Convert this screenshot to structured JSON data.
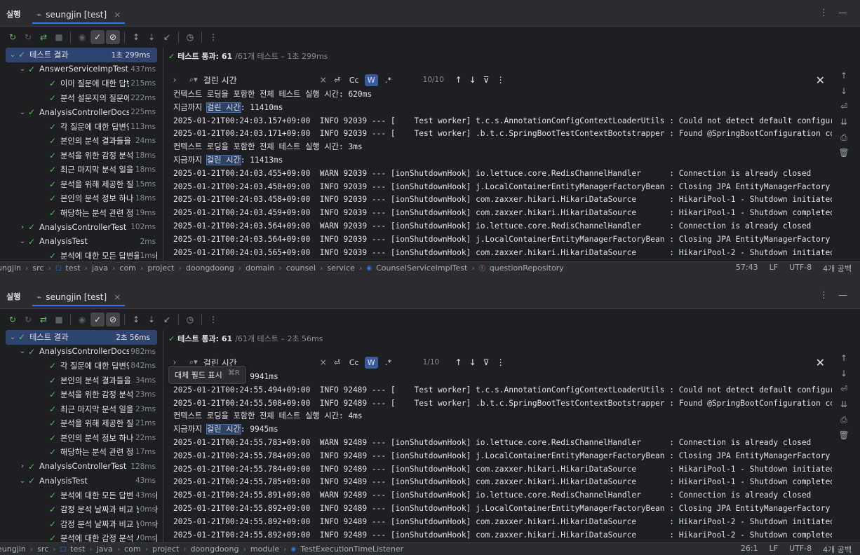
{
  "panels": [
    {
      "run_label": "실행",
      "tab_title": "seungjin [test]",
      "status": {
        "passed": "테스트 통과: 61",
        "rest": "/61개 테스트 – 1초 299ms"
      },
      "search": {
        "query": "걸린 시간",
        "match_count": "10/10",
        "case_label": "Cc",
        "word_label": "W",
        "regex_label": ".*"
      },
      "tree": [
        {
          "level": 0,
          "chev": "v",
          "name": "테스트 결과",
          "time": "1초 299ms",
          "selected": true
        },
        {
          "level": 1,
          "chev": "v",
          "name": "AnswerServiceImpTest",
          "time": "437ms"
        },
        {
          "level": 2,
          "chev": "",
          "name": "이미 질문에 대한 답변이 존",
          "time": "215ms"
        },
        {
          "level": 2,
          "chev": "",
          "name": "분석 설문지의 질문에 대한",
          "time": "222ms"
        },
        {
          "level": 1,
          "chev": "v",
          "name": "AnalysisControllerDocsTest",
          "time": "225ms"
        },
        {
          "level": 2,
          "chev": "",
          "name": "각 질문에 대한 답변인 응답",
          "time": "113ms"
        },
        {
          "level": 2,
          "chev": "",
          "name": "본인의 분석 결과들을 페이지",
          "time": "24ms"
        },
        {
          "level": 2,
          "chev": "",
          "name": "분석을 위한 감정 분석 설문",
          "time": "18ms"
        },
        {
          "level": 2,
          "chev": "",
          "name": "최근 마지막 분석 일을 기준",
          "time": "18ms"
        },
        {
          "level": 2,
          "chev": "",
          "name": "분석을 위해 제공한 질문들",
          "time": "15ms"
        },
        {
          "level": 2,
          "chev": "",
          "name": "본인의 분석 정보 하나를 조",
          "time": "18ms"
        },
        {
          "level": 2,
          "chev": "",
          "name": "해당하는 분석 관련 정보를",
          "time": "19ms"
        },
        {
          "level": 1,
          "chev": ">",
          "name": "AnalysisControllerTest",
          "time": "102ms"
        },
        {
          "level": 1,
          "chev": "v",
          "name": "AnalysisTest",
          "time": "2ms"
        },
        {
          "level": 2,
          "chev": "",
          "name": "분석에 대한 모든 답변을 행태",
          "time": "1ms"
        }
      ],
      "console": [
        "컨텍스트 로딩을 포함한 전체 테스트 실행 시간: 620ms",
        "지금까지 |걸린 시간|: 11410ms",
        "2025-01-21T00:24:03.157+09:00  INFO 92039 --- [    Test worker] t.c.s.AnnotationConfigContextLoaderUtils : Could not detect default configura",
        "2025-01-21T00:24:03.171+09:00  INFO 92039 --- [    Test worker] .b.t.c.SpringBootTestContextBootstrapper : Found @SpringBootConfiguration com",
        "컨텍스트 로딩을 포함한 전체 테스트 실행 시간: 3ms",
        "지금까지 |걸린 시간|: 11413ms",
        "2025-01-21T00:24:03.455+09:00  WARN 92039 --- [ionShutdownHook] io.lettuce.core.RedisChannelHandler      : Connection is already closed",
        "2025-01-21T00:24:03.458+09:00  INFO 92039 --- [ionShutdownHook] j.LocalContainerEntityManagerFactoryBean : Closing JPA EntityManagerFactory f",
        "2025-01-21T00:24:03.458+09:00  INFO 92039 --- [ionShutdownHook] com.zaxxer.hikari.HikariDataSource       : HikariPool-1 - Shutdown initiated.",
        "2025-01-21T00:24:03.459+09:00  INFO 92039 --- [ionShutdownHook] com.zaxxer.hikari.HikariDataSource       : HikariPool-1 - Shutdown completed.",
        "2025-01-21T00:24:03.564+09:00  WARN 92039 --- [ionShutdownHook] io.lettuce.core.RedisChannelHandler      : Connection is already closed",
        "2025-01-21T00:24:03.564+09:00  INFO 92039 --- [ionShutdownHook] j.LocalContainerEntityManagerFactoryBean : Closing JPA EntityManagerFactory f",
        "2025-01-21T00:24:03.565+09:00  INFO 92039 --- [ionShutdownHook] com.zaxxer.hikari.HikariDataSource       : HikariPool-2 - Shutdown initiated."
      ],
      "breadcrumb": [
        "ungjin",
        "src",
        "test",
        "java",
        "com",
        "project",
        "doongdoong",
        "domain",
        "counsel",
        "service",
        "CounselServiceImplTest",
        "questionRepository"
      ],
      "status_right": [
        "57:43",
        "LF",
        "UTF-8",
        "4개 공백"
      ]
    },
    {
      "run_label": "실행",
      "tab_title": "seungjin [test]",
      "status": {
        "passed": "테스트 통과: 61",
        "rest": "/61개 테스트 – 2초 56ms"
      },
      "search": {
        "query": "걸린 시간",
        "match_count": "1/10",
        "case_label": "Cc",
        "word_label": "W",
        "regex_label": ".*"
      },
      "tooltip": {
        "label": "대체 필드 표시",
        "shortcut": "⌘R"
      },
      "tree": [
        {
          "level": 0,
          "chev": "v",
          "name": "테스트 결과",
          "time": "2초 56ms",
          "selected": true
        },
        {
          "level": 1,
          "chev": "v",
          "name": "AnalysisControllerDocsTest",
          "time": "982ms"
        },
        {
          "level": 2,
          "chev": "",
          "name": "각 질문에 대한 답변인 응답",
          "time": "842ms"
        },
        {
          "level": 2,
          "chev": "",
          "name": "본인의 분석 결과들을 페이지",
          "time": "34ms"
        },
        {
          "level": 2,
          "chev": "",
          "name": "분석을 위한 감정 분석 설문",
          "time": "23ms"
        },
        {
          "level": 2,
          "chev": "",
          "name": "최근 마지막 분석 일을 기준",
          "time": "23ms"
        },
        {
          "level": 2,
          "chev": "",
          "name": "분석을 위해 제공한 질문들",
          "time": "21ms"
        },
        {
          "level": 2,
          "chev": "",
          "name": "본인의 분석 정보 하나를 조",
          "time": "22ms"
        },
        {
          "level": 2,
          "chev": "",
          "name": "해당하는 분석 관련 정보를",
          "time": "17ms"
        },
        {
          "level": 1,
          "chev": ">",
          "name": "AnalysisControllerTest",
          "time": "128ms"
        },
        {
          "level": 1,
          "chev": "v",
          "name": "AnalysisTest",
          "time": "43ms"
        },
        {
          "level": 2,
          "chev": "",
          "name": "분석에 대한 모든 답변을 행태",
          "time": "43ms"
        },
        {
          "level": 2,
          "chev": "",
          "name": "감정 분석 날짜과 비교 날짜가",
          "time": "0ms"
        },
        {
          "level": 2,
          "chev": "",
          "name": "감정 분석 날짜과 비교 날짜가",
          "time": "0ms"
        },
        {
          "level": 2,
          "chev": "",
          "name": "분석에 대한 감정 분석 시간이",
          "time": "0ms"
        }
      ],
      "console": [
        "지금까지 |걸린 시간|: 9941ms",
        "2025-01-21T00:24:55.494+09:00  INFO 92489 --- [    Test worker] t.c.s.AnnotationConfigContextLoaderUtils : Could not detect default configura",
        "2025-01-21T00:24:55.508+09:00  INFO 92489 --- [    Test worker] .b.t.c.SpringBootTestContextBootstrapper : Found @SpringBootConfiguration com",
        "컨텍스트 로딩을 포함한 전체 테스트 실행 시간: 4ms",
        "지금까지 |걸린 시간|: 9945ms",
        "2025-01-21T00:24:55.783+09:00  WARN 92489 --- [ionShutdownHook] io.lettuce.core.RedisChannelHandler      : Connection is already closed",
        "2025-01-21T00:24:55.784+09:00  INFO 92489 --- [ionShutdownHook] j.LocalContainerEntityManagerFactoryBean : Closing JPA EntityManagerFactory f",
        "2025-01-21T00:24:55.784+09:00  INFO 92489 --- [ionShutdownHook] com.zaxxer.hikari.HikariDataSource       : HikariPool-1 - Shutdown initiated.",
        "2025-01-21T00:24:55.785+09:00  INFO 92489 --- [ionShutdownHook] com.zaxxer.hikari.HikariDataSource       : HikariPool-1 - Shutdown completed.",
        "2025-01-21T00:24:55.891+09:00  WARN 92489 --- [ionShutdownHook] io.lettuce.core.RedisChannelHandler      : Connection is already closed",
        "2025-01-21T00:24:55.892+09:00  INFO 92489 --- [ionShutdownHook] j.LocalContainerEntityManagerFactoryBean : Closing JPA EntityManagerFactory f",
        "2025-01-21T00:24:55.892+09:00  INFO 92489 --- [ionShutdownHook] com.zaxxer.hikari.HikariDataSource       : HikariPool-2 - Shutdown initiated.",
        "2025-01-21T00:24:55.892+09:00  INFO 92489 --- [ionShutdownHook] com.zaxxer.hikari.HikariDataSource       : HikariPool-2 - Shutdown completed."
      ],
      "breadcrumb": [
        "eungjin",
        "src",
        "test",
        "java",
        "com",
        "project",
        "doongdoong",
        "module",
        "TestExecutionTimeListener"
      ],
      "status_right": [
        "26:1",
        "LF",
        "UTF-8",
        "4개 공백"
      ]
    }
  ],
  "icons": {
    "toolbar": [
      "rerun-icon",
      "rerun-failed-icon",
      "toggle-auto-test-icon",
      "stop-icon",
      "show-passed-eye-icon",
      "show-passed-check-icon",
      "show-ignored-icon",
      "sort-alpha-icon",
      "sort-duration-icon",
      "import-tests-icon",
      "history-icon",
      "more-icon"
    ],
    "right_side": [
      "up-arrow-icon",
      "down-arrow-icon",
      "soft-wrap-icon",
      "scroll-to-end-icon",
      "print-icon",
      "trash-icon"
    ]
  },
  "colors": {
    "accent": "#3574f0",
    "pass_green": "#5fb865",
    "highlight": "#2e4368"
  }
}
